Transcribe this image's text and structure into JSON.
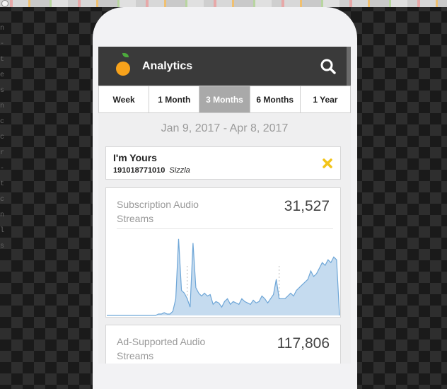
{
  "app": {
    "title": "Analytics"
  },
  "tabs": [
    {
      "label": "Week",
      "active": false
    },
    {
      "label": "1 Month",
      "active": false
    },
    {
      "label": "3 Months",
      "active": true
    },
    {
      "label": "6 Months",
      "active": false
    },
    {
      "label": "1 Year",
      "active": false
    }
  ],
  "date_range": "Jan 9, 2017 - Apr 8, 2017",
  "song": {
    "title": "I'm Yours",
    "id": "191018771010",
    "artist": "Sizzla"
  },
  "stats": [
    {
      "label": "Subscription Audio Streams",
      "value": "31,527"
    },
    {
      "label": "Ad-Supported Audio Streams",
      "value": "117,806"
    }
  ],
  "colors": {
    "appbar": "#3a3a3a",
    "active_tab": "#a9a9a9",
    "chart_fill": "#c5dbef",
    "chart_line": "#6ea6d7",
    "remove_icon": "#f2c418",
    "logo_orange": "#f7a21b"
  },
  "icons": {
    "logo": "orange-fruit-icon",
    "search": "search-icon",
    "remove": "close-x-icon"
  },
  "chart_data": {
    "type": "area",
    "series": [
      {
        "values": [
          0,
          0,
          0,
          0,
          0,
          0,
          0,
          0,
          0,
          0,
          0,
          0,
          0,
          0,
          0,
          0,
          0,
          0,
          1,
          1,
          2,
          1,
          1,
          3,
          12,
          55,
          18,
          16,
          12,
          6,
          52,
          20,
          16,
          14,
          16,
          14,
          15,
          8,
          10,
          9,
          6,
          10,
          12,
          8,
          10,
          9,
          8,
          12,
          10,
          9,
          8,
          11,
          9,
          10,
          14,
          12,
          9,
          12,
          15,
          26,
          12,
          12,
          12,
          14,
          16,
          14,
          18,
          20,
          22,
          24,
          26,
          32,
          28,
          30,
          34,
          38,
          36,
          40,
          38,
          42,
          40,
          0
        ]
      }
    ],
    "markers": [
      28,
      60
    ]
  }
}
